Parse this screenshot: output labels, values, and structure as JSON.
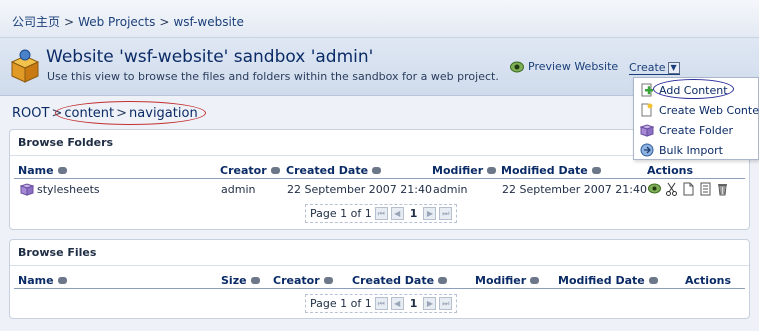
{
  "breadcrumb": {
    "items": [
      "公司主页",
      "Web Projects",
      "wsf-website"
    ],
    "sep": ">"
  },
  "header": {
    "title": "Website 'wsf-website' sandbox 'admin'",
    "subtitle": "Use this view to browse the files and folders within the sandbox for a web project.",
    "preview_label": "Preview Website",
    "create_label": "Create"
  },
  "path": {
    "root": "ROOT",
    "sep": ">",
    "segments": [
      "content",
      "navigation"
    ]
  },
  "folders": {
    "title": "Browse Folders",
    "columns": [
      "Name",
      "Creator",
      "Created Date",
      "Modifier",
      "Modified Date",
      "Actions"
    ],
    "rows": [
      {
        "name": "stylesheets",
        "creator": "admin",
        "created": "22 September 2007 21:40",
        "modifier": "admin",
        "modified": "22 September 2007 21:40"
      }
    ],
    "pager": {
      "text": "Page 1 of 1",
      "current": "1"
    }
  },
  "files": {
    "title": "Browse Files",
    "columns": [
      "Name",
      "Size",
      "Creator",
      "Created Date",
      "Modifier",
      "Modified Date",
      "Actions"
    ],
    "pager": {
      "text": "Page 1 of 1",
      "current": "1"
    }
  },
  "create_menu": {
    "items": [
      {
        "label": "Add Content",
        "icon": "add-icon"
      },
      {
        "label": "Create Web Content",
        "icon": "new-document-icon"
      },
      {
        "label": "Create Folder",
        "icon": "folder-icon"
      },
      {
        "label": "Bulk Import",
        "icon": "import-icon"
      }
    ]
  },
  "colors": {
    "link": "#1b3f7a",
    "title": "#0b2b66",
    "annotation_red": "#c23030",
    "annotation_blue": "#2a2d9c"
  }
}
